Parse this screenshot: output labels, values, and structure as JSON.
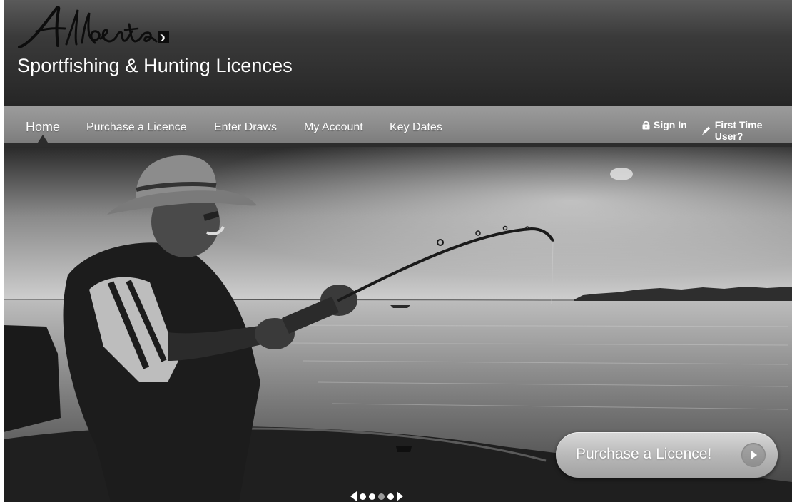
{
  "header": {
    "logo_text": "Alberta",
    "site_title": "Sportfishing & Hunting Licences"
  },
  "nav": {
    "items": [
      {
        "label": "Home",
        "active": true
      },
      {
        "label": "Purchase a Licence",
        "active": false
      },
      {
        "label": "Enter Draws",
        "active": false
      },
      {
        "label": "My Account",
        "active": false
      },
      {
        "label": "Key Dates",
        "active": false
      }
    ],
    "sign_in": {
      "label": "Sign In",
      "icon": "lock-icon"
    },
    "first_time": {
      "label": "First Time User?",
      "icon": "pencil-icon"
    }
  },
  "hero": {
    "cta_label": "Purchase a Licence!",
    "cta_icon": "play-arrow-icon",
    "carousel": {
      "dot_count": 4,
      "active_index": 2
    }
  },
  "colors": {
    "header_bg": "#2a2a2a",
    "nav_bg": "#8f8f8f",
    "cta_bg": "#b8b8b8",
    "text": "#ffffff"
  }
}
